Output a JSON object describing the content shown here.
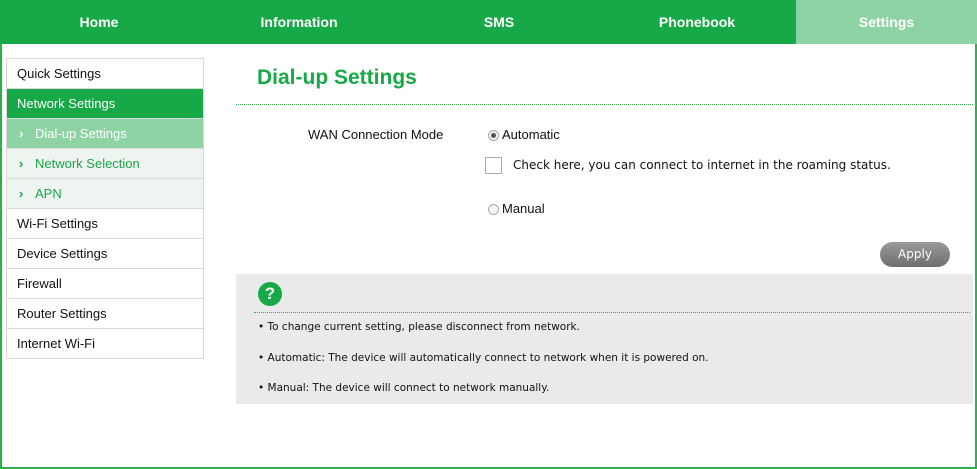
{
  "nav": {
    "tabs": [
      {
        "label": "Home"
      },
      {
        "label": "Information"
      },
      {
        "label": "SMS"
      },
      {
        "label": "Phonebook"
      },
      {
        "label": "Settings"
      }
    ]
  },
  "sidebar": {
    "items": [
      {
        "label": "Quick Settings"
      },
      {
        "label": "Network Settings"
      },
      {
        "label": "Dial-up Settings"
      },
      {
        "label": "Network Selection"
      },
      {
        "label": "APN"
      },
      {
        "label": "Wi-Fi Settings"
      },
      {
        "label": "Device Settings"
      },
      {
        "label": "Firewall"
      },
      {
        "label": "Router Settings"
      },
      {
        "label": "Internet Wi-Fi"
      }
    ],
    "chevron": "›"
  },
  "main": {
    "title": "Dial-up Settings",
    "wan_label": "WAN Connection Mode",
    "automatic_label": "Automatic",
    "roaming_label": "Check here, you can connect to internet in the roaming status.",
    "manual_label": "Manual",
    "apply_label": "Apply"
  },
  "help": {
    "icon": "?",
    "lines": [
      "• To change current setting, please disconnect from network.",
      "• Automatic: The device will automatically connect to network when it is powered on.",
      "• Manual: The device will connect to network manually."
    ]
  },
  "colors": {
    "brand_green": "#17a947",
    "active_green": "#8dd3a4"
  }
}
